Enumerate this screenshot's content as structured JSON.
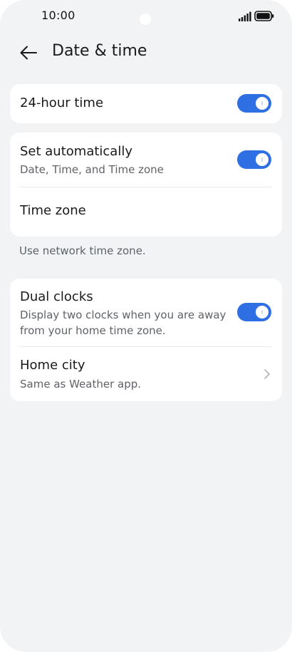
{
  "status_bar": {
    "time": "10:00",
    "icons": [
      "signal-icon",
      "battery-icon"
    ]
  },
  "header": {
    "title": "Date & time",
    "back_icon": "arrow-left-icon"
  },
  "settings": {
    "hour24": {
      "title": "24-hour time",
      "enabled": true
    },
    "set_automatically": {
      "title": "Set automatically",
      "subtitle": "Date, Time, and Time zone",
      "enabled": true
    },
    "time_zone": {
      "title": "Time zone"
    },
    "network_note": "Use network time zone.",
    "dual_clocks": {
      "title": "Dual clocks",
      "subtitle": "Display two clocks when you are away from your home time zone.",
      "enabled": true
    },
    "home_city": {
      "title": "Home city",
      "subtitle": "Same as Weather app.",
      "icon": "chevron-right-icon"
    }
  },
  "colors": {
    "background": "#f1f3f5",
    "card": "#ffffff",
    "accent": "#2f6fe4",
    "text_primary": "#1a1a1a",
    "text_secondary": "#5f6368"
  }
}
